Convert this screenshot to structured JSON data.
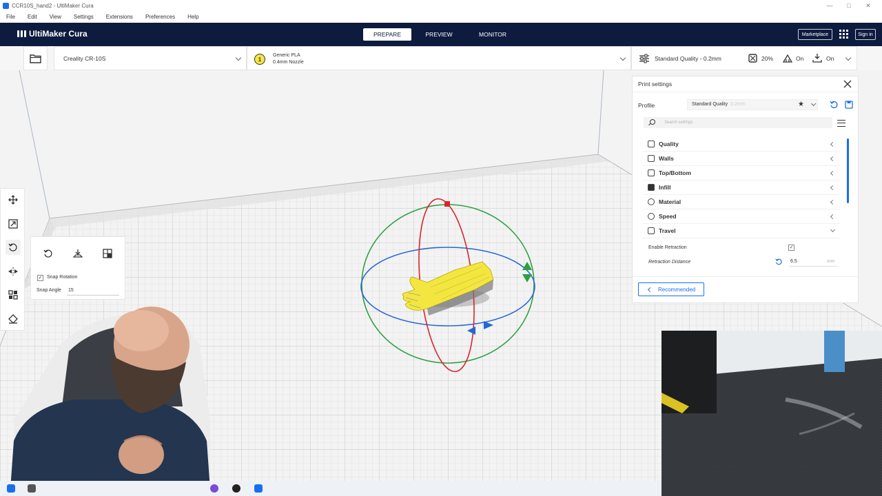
{
  "window": {
    "title": "CCR10S_hand2 - UltiMaker Cura"
  },
  "menu": [
    "File",
    "Edit",
    "View",
    "Settings",
    "Extensions",
    "Preferences",
    "Help"
  ],
  "header": {
    "brand": "UltiMaker Cura",
    "stages": [
      "PREPARE",
      "PREVIEW",
      "MONITOR"
    ],
    "active_stage": "PREPARE",
    "marketplace_label": "Marketplace",
    "signin_label": "Sign in"
  },
  "toolbar": {
    "printer": "Creality CR-10S",
    "extruder_number": "1",
    "material": "Generic PLA",
    "nozzle": "0.4mm Nozzle",
    "profile": "Standard Quality - 0.2mm",
    "infill": "20%",
    "support": "On",
    "adhesion": "On"
  },
  "rotate_tool": {
    "snap_rotation_label": "Snap Rotation",
    "snap_rotation_checked": true,
    "snap_angle_label": "Snap Angle",
    "snap_angle_value": "15"
  },
  "print_settings": {
    "title": "Print settings",
    "profile_label": "Profile",
    "profile_value": "Standard Quality",
    "profile_suffix": "0.2mm",
    "search_placeholder": "Search settings",
    "categories": [
      {
        "label": "Quality",
        "expanded": false
      },
      {
        "label": "Walls",
        "expanded": false
      },
      {
        "label": "Top/Bottom",
        "expanded": false
      },
      {
        "label": "Infill",
        "expanded": false
      },
      {
        "label": "Material",
        "expanded": false
      },
      {
        "label": "Speed",
        "expanded": false
      },
      {
        "label": "Travel",
        "expanded": true
      }
    ],
    "travel_settings": [
      {
        "label": "Enable Retraction",
        "type": "checkbox",
        "checked": true
      },
      {
        "label": "Retraction Distance",
        "type": "value",
        "value": "6.5",
        "unit": "mm"
      }
    ],
    "recommended_label": "Recommended"
  },
  "colors": {
    "header_bg": "#0d1b3e",
    "accent": "#196ef0",
    "gizmo_red": "#d8242d",
    "gizmo_green": "#2ea043",
    "gizmo_blue": "#2666d8",
    "model_yellow": "#f4e640"
  }
}
